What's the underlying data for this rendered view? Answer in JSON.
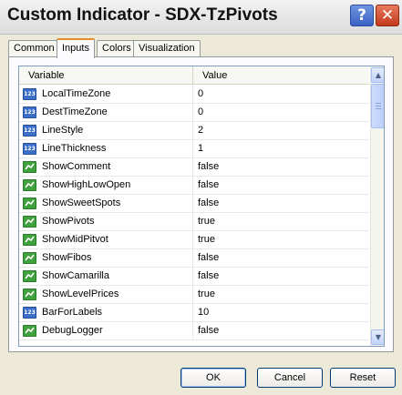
{
  "window": {
    "title": "Custom Indicator - SDX-TzPivots",
    "help_label": "?",
    "close_label": "✕"
  },
  "tabs": [
    {
      "label": "Common",
      "active": false
    },
    {
      "label": "Inputs",
      "active": true
    },
    {
      "label": "Colors",
      "active": false
    },
    {
      "label": "Visualization",
      "active": false
    }
  ],
  "grid": {
    "columns": {
      "variable": "Variable",
      "value": "Value"
    },
    "rows": [
      {
        "icon": "numeric-param-icon",
        "icon_text": "123",
        "variable": "LocalTimeZone",
        "value": "0"
      },
      {
        "icon": "numeric-param-icon",
        "icon_text": "123",
        "variable": "DestTimeZone",
        "value": "0"
      },
      {
        "icon": "numeric-param-icon",
        "icon_text": "123",
        "variable": "LineStyle",
        "value": "2"
      },
      {
        "icon": "numeric-param-icon",
        "icon_text": "123",
        "variable": "LineThickness",
        "value": "1"
      },
      {
        "icon": "bool-param-icon",
        "variable": "ShowComment",
        "value": "false"
      },
      {
        "icon": "bool-param-icon",
        "variable": "ShowHighLowOpen",
        "value": "false"
      },
      {
        "icon": "bool-param-icon",
        "variable": "ShowSweetSpots",
        "value": "false"
      },
      {
        "icon": "bool-param-icon",
        "variable": "ShowPivots",
        "value": "true"
      },
      {
        "icon": "bool-param-icon",
        "variable": "ShowMidPitvot",
        "value": "true"
      },
      {
        "icon": "bool-param-icon",
        "variable": "ShowFibos",
        "value": "false"
      },
      {
        "icon": "bool-param-icon",
        "variable": "ShowCamarilla",
        "value": "false"
      },
      {
        "icon": "bool-param-icon",
        "variable": "ShowLevelPrices",
        "value": "true"
      },
      {
        "icon": "numeric-param-icon",
        "icon_text": "123",
        "variable": "BarForLabels",
        "value": "10"
      },
      {
        "icon": "bool-param-icon",
        "variable": "DebugLogger",
        "value": "false"
      }
    ]
  },
  "scrollbar": {
    "up_glyph": "▲",
    "down_glyph": "▼"
  },
  "buttons": {
    "ok": "OK",
    "cancel": "Cancel",
    "reset": "Reset"
  },
  "colors": {
    "accent": "#e68b2c",
    "numeric_icon": "#3b6fc9",
    "bool_icon": "#3fa23f",
    "button_border": "#003c74"
  }
}
